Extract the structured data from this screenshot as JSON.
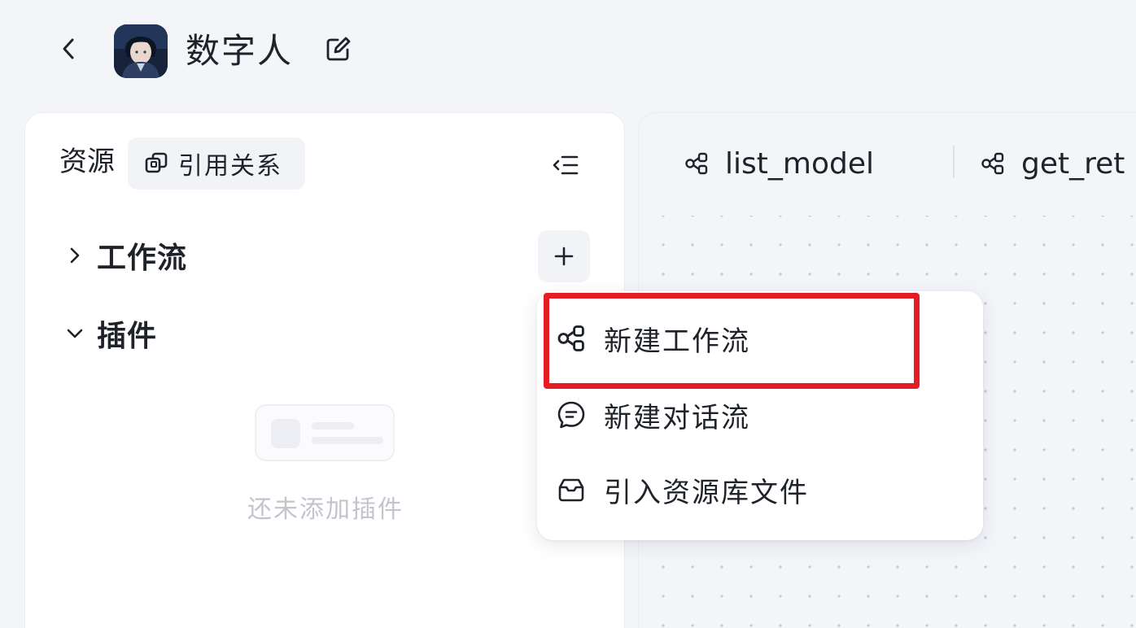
{
  "header": {
    "back_icon": "chevron-left-icon",
    "title": "数字人",
    "edit_icon": "edit-icon"
  },
  "sidebar": {
    "title": "资源",
    "reference_button": {
      "label": "引用关系",
      "icon": "link-copy-icon"
    },
    "collapse_icon": "collapse-list-icon",
    "sections": [
      {
        "label": "工作流",
        "expanded": false,
        "icon": "chevron-right-icon"
      },
      {
        "label": "插件",
        "expanded": true,
        "icon": "chevron-down-icon"
      }
    ],
    "add_icon": "plus-icon",
    "empty_text": "还未添加插件"
  },
  "canvas": {
    "tabs": [
      {
        "label": "list_model",
        "icon": "workflow-icon"
      },
      {
        "label": "get_ret",
        "icon": "workflow-icon"
      }
    ]
  },
  "menu": {
    "items": [
      {
        "label": "新建工作流",
        "icon": "workflow-icon",
        "highlighted": true
      },
      {
        "label": "新建对话流",
        "icon": "chat-bubble-icon",
        "highlighted": false
      },
      {
        "label": "引入资源库文件",
        "icon": "inbox-icon",
        "highlighted": false
      }
    ]
  },
  "colors": {
    "highlight": "#e51c23",
    "background": "#f4f5f9",
    "panel": "#ffffff"
  }
}
